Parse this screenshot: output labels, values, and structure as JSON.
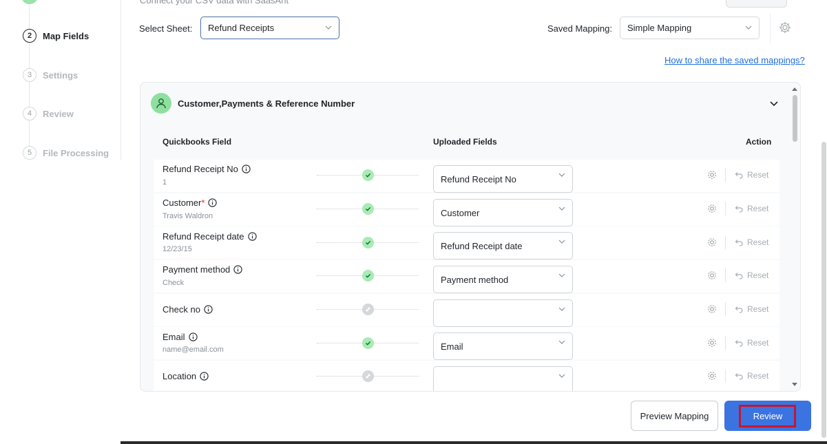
{
  "header": {
    "subtitle": "Connect your CSV data with SaasAnt"
  },
  "stepper": {
    "steps": [
      {
        "number": "2",
        "label": "Map Fields",
        "active": true
      },
      {
        "number": "3",
        "label": "Settings",
        "active": false
      },
      {
        "number": "4",
        "label": "Review",
        "active": false
      },
      {
        "number": "5",
        "label": "File Processing",
        "active": false
      }
    ]
  },
  "toolbar": {
    "sheet_label": "Select Sheet:",
    "sheet_value": "Refund Receipts",
    "mapping_label": "Saved Mapping:",
    "mapping_value": "Simple Mapping",
    "help_link": "How to share the saved mappings?"
  },
  "section": {
    "title": "Customer,Payments & Reference Number",
    "columns": {
      "quickbooks": "Quickbooks Field",
      "uploaded": "Uploaded Fields",
      "action": "Action"
    },
    "rows": [
      {
        "field": "Refund Receipt No",
        "required": false,
        "sample": "1",
        "mapped": true,
        "value": "Refund Receipt No",
        "reset": "Reset"
      },
      {
        "field": "Customer",
        "required": true,
        "sample": "Travis Waldron",
        "mapped": true,
        "value": "Customer",
        "reset": "Reset"
      },
      {
        "field": "Refund Receipt date",
        "required": false,
        "sample": "12/23/15",
        "mapped": true,
        "value": "Refund Receipt date",
        "reset": "Reset"
      },
      {
        "field": "Payment method",
        "required": false,
        "sample": "Check",
        "mapped": true,
        "value": "Payment method",
        "reset": "Reset"
      },
      {
        "field": "Check no",
        "required": false,
        "sample": "",
        "mapped": false,
        "value": "",
        "reset": "Reset"
      },
      {
        "field": "Email",
        "required": false,
        "sample": "name@email.com",
        "mapped": true,
        "value": "Email",
        "reset": "Reset"
      },
      {
        "field": "Location",
        "required": false,
        "sample": "",
        "mapped": false,
        "value": "",
        "reset": "Reset"
      }
    ]
  },
  "footer": {
    "preview_label": "Preview Mapping",
    "review_label": "Review"
  },
  "colors": {
    "accent": "#3b74e0",
    "success": "#a8ebb4",
    "highlight": "#c5162f",
    "link": "#1e6fd9"
  },
  "icons": {
    "status_ok": "check-circle-icon",
    "status_none": "link-icon",
    "info": "info-icon",
    "settings": "gear-icon",
    "reset": "undo-icon",
    "collapse": "chevron-down-icon",
    "section": "user-icon"
  }
}
